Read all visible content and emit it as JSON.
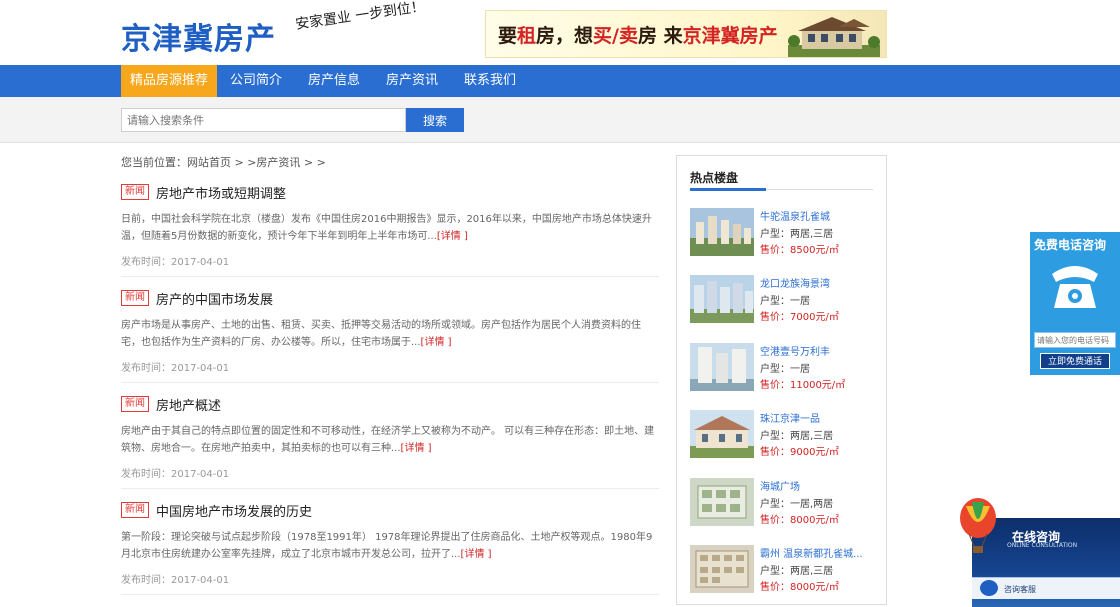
{
  "header": {
    "logo": "京津冀房产",
    "slogan": "安家置业 一步到位！",
    "banner": {
      "part1": "要",
      "hl1": "租",
      "part2": "房，想",
      "hl2": "买/卖",
      "part3": "房 来",
      "hl3": "京津冀房产"
    }
  },
  "nav": {
    "items": [
      {
        "label": "精品房源推荐",
        "active": true
      },
      {
        "label": "公司简介"
      },
      {
        "label": "房产信息"
      },
      {
        "label": "房产资讯"
      },
      {
        "label": "联系我们"
      }
    ]
  },
  "search": {
    "placeholder": "请输入搜索条件",
    "button": "搜索"
  },
  "breadcrumb": "您当前位置：网站首页 > >房产资讯 > >",
  "articles": [
    {
      "tag": "新闻",
      "title": "房地产市场或短期调整",
      "summary": "日前，中国社会科学院在北京（楼盘）发布《中国住房2016中期报告》显示，2016年以来，中国房地产市场总体快速升温，但随着5月份数据的新变化，预计今年下半年到明年上半年市场可...",
      "detail": "[详情 ]",
      "date": "发布时间：2017-04-01"
    },
    {
      "tag": "新闻",
      "title": "房产的中国市场发展",
      "summary": "房产市场是从事房产、土地的出售、租赁、买卖、抵押等交易活动的场所或领域。房产包括作为居民个人消费资料的住宅，也包括作为生产资料的厂房、办公楼等。所以，住宅市场属于...",
      "detail": "[详情 ]",
      "date": "发布时间：2017-04-01"
    },
    {
      "tag": "新闻",
      "title": "房地产概述",
      "summary": "房地产由于其自己的特点即位置的固定性和不可移动性，在经济学上又被称为不动产。 可以有三种存在形态：即土地、建筑物、房地合一。在房地产拍卖中，其拍卖标的也可以有三种...",
      "detail": "[详情 ]",
      "date": "发布时间：2017-04-01"
    },
    {
      "tag": "新闻",
      "title": "中国房地产市场发展的历史",
      "summary": "第一阶段：理论突破与试点起步阶段（1978至1991年） 1978年理论界提出了住房商品化、土地产权等观点。1980年9月北京市住房统建办公室率先挂牌，成立了北京市城市开发总公司，拉开了...",
      "detail": "[详情 ]",
      "date": "发布时间：2017-04-01"
    }
  ],
  "sidebar": {
    "title": "热点楼盘",
    "listings": [
      {
        "name": "牛驼温泉孔雀城",
        "type": "户型：两居,三居",
        "price": "售价：8500元/㎡"
      },
      {
        "name": "龙口龙族海景湾",
        "type": "户型：一居",
        "price": "售价：7000元/㎡"
      },
      {
        "name": "空港壹号万利丰",
        "type": "户型：一居",
        "price": "售价：11000元/㎡"
      },
      {
        "name": "珠江京津一品",
        "type": "户型：两居,三居",
        "price": "售价：9000元/㎡"
      },
      {
        "name": "海城广场",
        "type": "户型：一居,两居",
        "price": "售价：8000元/㎡"
      },
      {
        "name": "霸州 温泉新都孔雀城...",
        "type": "户型：两居,三居",
        "price": "售价：8000元/㎡"
      }
    ]
  },
  "phone_widget": {
    "title": "免费电话咨询",
    "placeholder": "请输入您的电话号码",
    "button": "立即免费通话"
  },
  "consult_widget": {
    "title": "在线咨询",
    "subtitle": "ONLINE CONSULTATION",
    "label": "咨询客服"
  },
  "colors": {
    "primary": "#2a6ed2",
    "accent": "#f6a71c",
    "price": "#d32323"
  }
}
